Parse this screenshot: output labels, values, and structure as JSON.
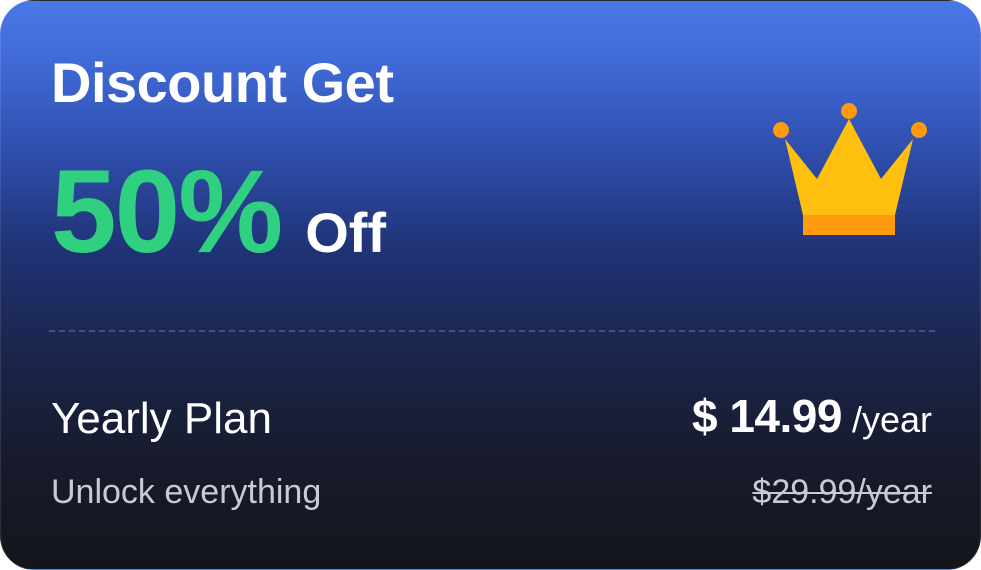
{
  "promo": {
    "headline": "Discount Get",
    "percent": "50%",
    "suffix": "Off",
    "icon": "crown-icon"
  },
  "plan": {
    "name": "Yearly Plan",
    "subtitle": "Unlock everything",
    "price": "$ 14.99",
    "period": "/year",
    "old_price": "$29.99/year"
  },
  "colors": {
    "accent_green": "#2fd07f",
    "crown_yellow": "#ffbf0f",
    "crown_orange": "#ff9a0e",
    "gradient_top": "#4a78e6",
    "gradient_bottom": "#14151b"
  }
}
